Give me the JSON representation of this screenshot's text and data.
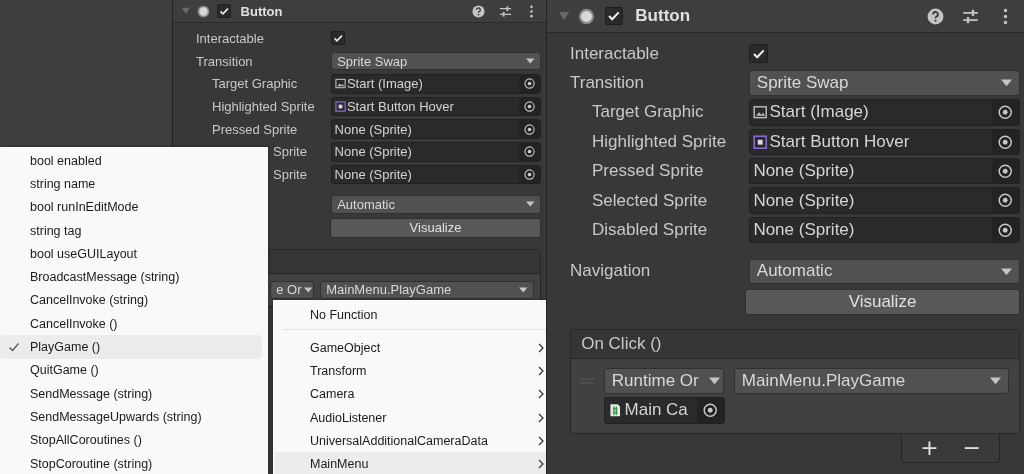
{
  "inspectors": [
    {
      "component": {
        "title": "Button",
        "enabled": true,
        "expanded": true
      },
      "interactable": {
        "label": "Interactable",
        "checked": true
      },
      "transition": {
        "label": "Transition",
        "value": "Sprite Swap"
      },
      "sprites": [
        {
          "label": "Target Graphic",
          "value": "Start (Image)",
          "kind": "image",
          "partial": false
        },
        {
          "label": "Highlighted Sprite",
          "value": "Start Button Hover",
          "kind": "sprite",
          "partial": false
        },
        {
          "label": "Pressed Sprite",
          "value": "None (Sprite)",
          "kind": "empty",
          "partial": false
        },
        {
          "label": "Sprite",
          "value": "None (Sprite)",
          "kind": "empty",
          "partial": true
        },
        {
          "label": "Sprite",
          "value": "None (Sprite)",
          "kind": "empty",
          "partial": true
        }
      ],
      "navigation": {
        "value": "Automatic"
      },
      "visualize": "Visualize",
      "on_click": {
        "mode": "e Or",
        "function": "MainMenu.PlayGame",
        "drag_handle": false
      }
    },
    {
      "component": {
        "title": "Button",
        "enabled": true,
        "expanded": true
      },
      "interactable": {
        "label": "Interactable",
        "checked": true
      },
      "transition": {
        "label": "Transition",
        "value": "Sprite Swap"
      },
      "sprites": [
        {
          "label": "Target Graphic",
          "value": "Start (Image)",
          "kind": "image",
          "partial": false
        },
        {
          "label": "Highlighted Sprite",
          "value": "Start Button Hover",
          "kind": "sprite",
          "partial": false
        },
        {
          "label": "Pressed Sprite",
          "value": "None (Sprite)",
          "kind": "empty",
          "partial": false
        },
        {
          "label": "Selected Sprite",
          "value": "None (Sprite)",
          "kind": "empty",
          "partial": false
        },
        {
          "label": "Disabled Sprite",
          "value": "None (Sprite)",
          "kind": "empty",
          "partial": false
        }
      ],
      "navigation": {
        "label": "Navigation",
        "value": "Automatic"
      },
      "visualize": "Visualize",
      "on_click": {
        "title": "On Click ()",
        "mode": "Runtime Or",
        "function": "MainMenu.PlayGame",
        "drag_handle": true,
        "target": {
          "value": "Main Ca",
          "kind": "script"
        },
        "add": "+",
        "remove": "−"
      }
    }
  ],
  "menus": [
    {
      "items": [
        {
          "label": "bool enabled",
          "checked": false,
          "selected": false
        },
        {
          "label": "string name",
          "checked": false,
          "selected": false
        },
        {
          "label": "bool runInEditMode",
          "checked": false,
          "selected": false
        },
        {
          "label": "string tag",
          "checked": false,
          "selected": false
        },
        {
          "label": "bool useGUILayout",
          "checked": false,
          "selected": false
        },
        {
          "label": "BroadcastMessage (string)",
          "checked": false,
          "selected": false
        },
        {
          "label": "CancelInvoke (string)",
          "checked": false,
          "selected": false
        },
        {
          "label": "CancelInvoke ()",
          "checked": false,
          "selected": false
        },
        {
          "label": "PlayGame ()",
          "checked": true,
          "selected": true
        },
        {
          "label": "QuitGame ()",
          "checked": false,
          "selected": false
        },
        {
          "label": "SendMessage (string)",
          "checked": false,
          "selected": false
        },
        {
          "label": "SendMessageUpwards (string)",
          "checked": false,
          "selected": false
        },
        {
          "label": "StopAllCoroutines ()",
          "checked": false,
          "selected": false
        },
        {
          "label": "StopCoroutine (string)",
          "checked": false,
          "selected": false
        }
      ]
    },
    {
      "items": [
        {
          "label": "No Function",
          "submenu": false,
          "separator_after": true,
          "selected": false
        },
        {
          "label": "GameObject",
          "submenu": true,
          "separator_after": false,
          "selected": false
        },
        {
          "label": "Transform",
          "submenu": true,
          "separator_after": false,
          "selected": false
        },
        {
          "label": "Camera",
          "submenu": true,
          "separator_after": false,
          "selected": false
        },
        {
          "label": "AudioListener",
          "submenu": true,
          "separator_after": false,
          "selected": false
        },
        {
          "label": "UniversalAdditionalCameraData",
          "submenu": true,
          "separator_after": false,
          "selected": false
        },
        {
          "label": "MainMenu",
          "submenu": true,
          "separator_after": false,
          "selected": true
        }
      ]
    }
  ]
}
